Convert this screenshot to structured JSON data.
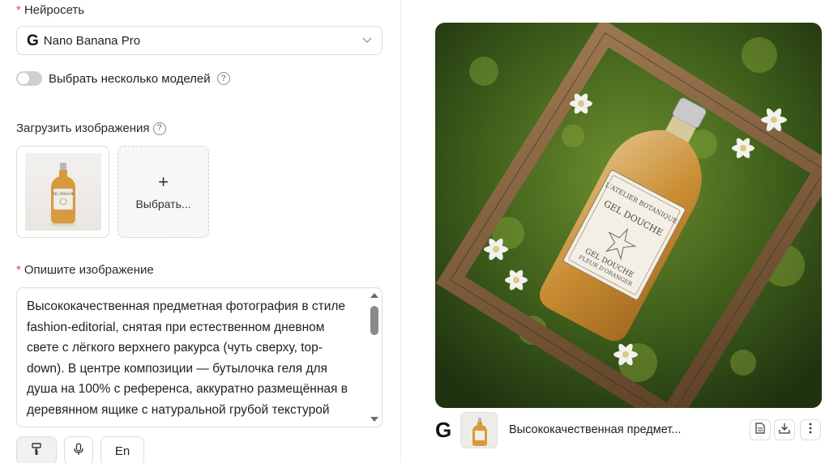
{
  "form": {
    "model_section": {
      "required_mark": "*",
      "label": "Нейросеть"
    },
    "model_select": {
      "value": "Nano Banana Pro",
      "icon": "google-g-icon"
    },
    "multi_model_toggle": {
      "label": "Выбрать несколько моделей",
      "on": false
    },
    "upload_section": {
      "label": "Загрузить изображения"
    },
    "upload_card": {
      "label": "Выбрать...",
      "icon": "plus-icon"
    },
    "description_section": {
      "required_mark": "*",
      "label": "Опишите изображение"
    },
    "description_text": "Высококачественная предметная фотография в стиле fashion-editorial, снятая при естественном дневном свете с лёгкого верхнего ракурса (чуть сверху, top-down). В центре композиции — бутылочка геля для душа на 100% с референса, аккуратно размещённая в деревянном ящике с натуральной грубой текстурой",
    "tools": {
      "brush_icon": "paint-roller-icon",
      "mic_icon": "microphone-icon",
      "language_label": "En"
    }
  },
  "result": {
    "product_label": {
      "brand": "L'ATELIER BOTANIQUE",
      "name": "GEL DOUCHE",
      "bottom": "GEL DOUCHE",
      "subtitle": "FLEUR D'ORANGER"
    },
    "thumb_label": "GEL DOUCHE",
    "footer": {
      "model_icon": "google-g-icon",
      "prompt_preview": "Высококачественная предмет...",
      "actions": [
        "document-icon",
        "download-icon",
        "more-icon"
      ]
    }
  },
  "colors": {
    "required": "#e5484d",
    "border": "#dcdcdc",
    "moss": "#3d5a1c",
    "wood": "#7a5a38",
    "liquid": "#d79a3e"
  }
}
